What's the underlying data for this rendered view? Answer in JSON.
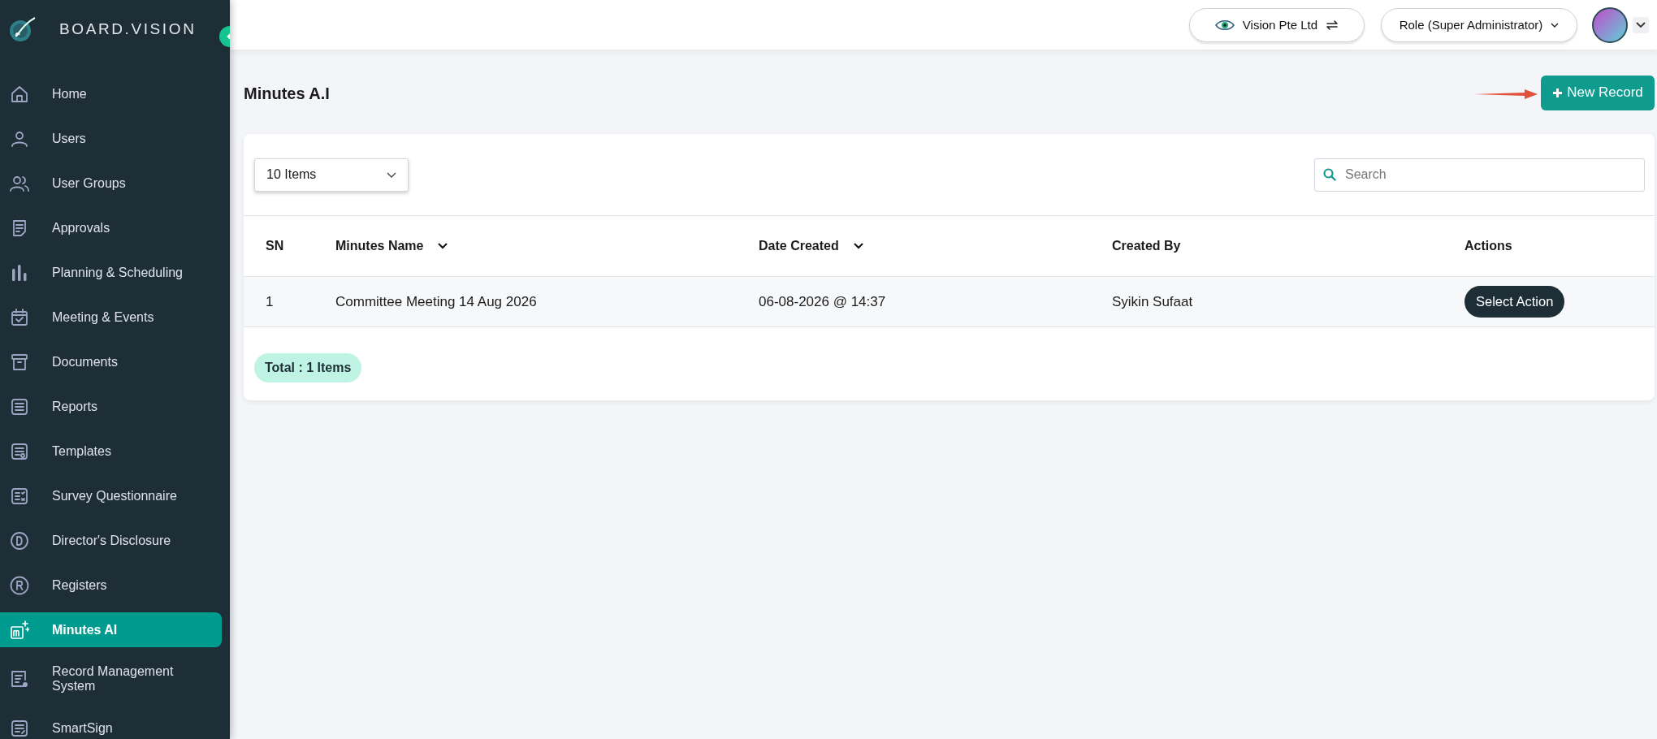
{
  "sidebar": {
    "brand": "BOARD.VISION",
    "items": [
      {
        "label": "Home",
        "selected": false
      },
      {
        "label": "Users",
        "selected": false
      },
      {
        "label": "User Groups",
        "selected": false
      },
      {
        "label": "Approvals",
        "selected": false
      },
      {
        "label": "Planning & Scheduling",
        "selected": false
      },
      {
        "label": "Meeting & Events",
        "selected": false
      },
      {
        "label": "Documents",
        "selected": false
      },
      {
        "label": "Reports",
        "selected": false
      },
      {
        "label": "Templates",
        "selected": false
      },
      {
        "label": "Survey Questionnaire",
        "selected": false
      },
      {
        "label": "Director's Disclosure",
        "selected": false
      },
      {
        "label": "Registers",
        "selected": false
      },
      {
        "label": "Minutes AI",
        "selected": true
      },
      {
        "label": "Record Management System",
        "selected": false
      },
      {
        "label": "SmartSign",
        "selected": false
      }
    ]
  },
  "topbar": {
    "company": "Vision Pte Ltd",
    "role": "Role (Super Administrator)"
  },
  "page": {
    "title": "Minutes A.I",
    "new_record": "New Record"
  },
  "table": {
    "page_size": "10 Items",
    "search": {
      "placeholder": "Search"
    },
    "columns": [
      {
        "label": "SN",
        "sortable": false
      },
      {
        "label": "Minutes Name",
        "sortable": true
      },
      {
        "label": "Date Created",
        "sortable": true
      },
      {
        "label": "Created By",
        "sortable": false
      },
      {
        "label": "Actions",
        "sortable": false
      }
    ],
    "rows": [
      {
        "cells": [
          "1",
          "Committee Meeting 14 Aug 2026",
          "06-08-2026 @ 14:37",
          "Syikin Sufaat"
        ],
        "action": "Select Action"
      }
    ],
    "total": "Total : 1 Items"
  }
}
